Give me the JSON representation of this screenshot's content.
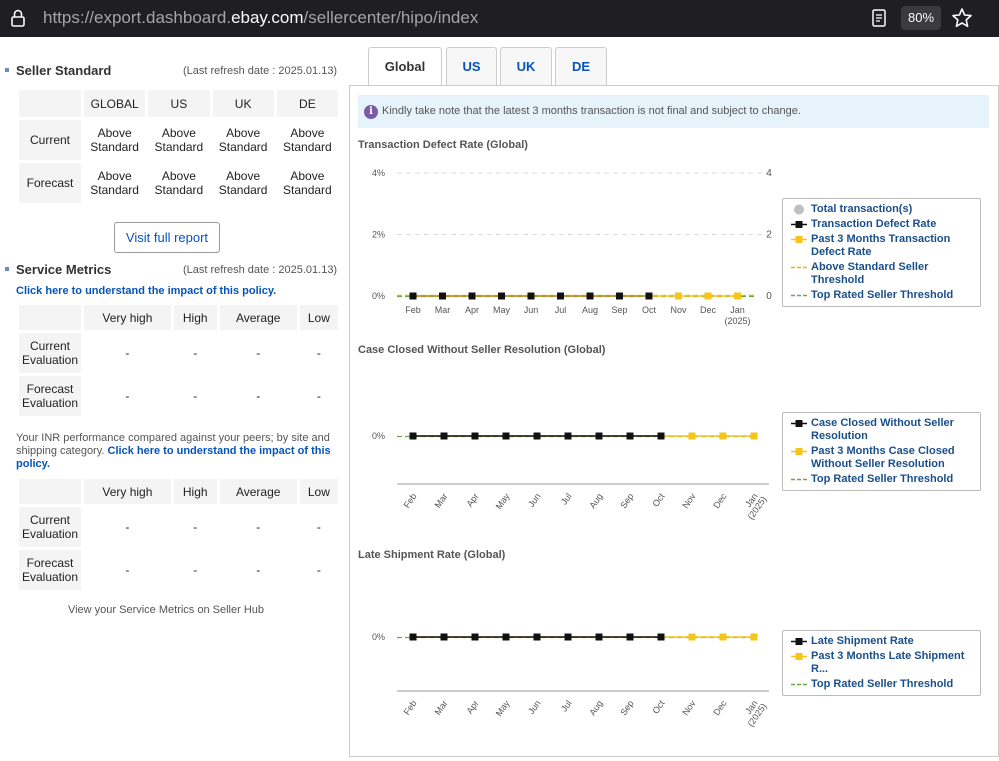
{
  "browser": {
    "url_prefix": "https://export.dashboard.",
    "url_domain": "ebay.com",
    "url_path": "/sellercenter/hipo/index",
    "zoom": "80%"
  },
  "seller_standard": {
    "title": "Seller Standard",
    "refresh": "(Last refresh date : 2025.01.13)",
    "columns": [
      "GLOBAL",
      "US",
      "UK",
      "DE"
    ],
    "rows": [
      {
        "label": "Current",
        "values": [
          "Above Standard",
          "Above Standard",
          "Above Standard",
          "Above Standard"
        ]
      },
      {
        "label": "Forecast",
        "values": [
          "Above Standard",
          "Above Standard",
          "Above Standard",
          "Above Standard"
        ]
      }
    ],
    "button": "Visit full report"
  },
  "service_metrics": {
    "title": "Service Metrics",
    "refresh": "(Last refresh date : 2025.01.13)",
    "policy_link": "Click here to understand the impact of this policy.",
    "columns": [
      "Very high",
      "High",
      "Average",
      "Low"
    ],
    "rows": [
      {
        "label": "Current Evaluation",
        "values": [
          "-",
          "-",
          "-",
          "-"
        ]
      },
      {
        "label": "Forecast Evaluation",
        "values": [
          "-",
          "-",
          "-",
          "-"
        ]
      }
    ],
    "inr_note": "Your INR performance compared against your peers; by site and shipping category.",
    "inr_link": "Click here to understand the impact of this policy.",
    "inr_rows": [
      {
        "label": "Current Evaluation",
        "values": [
          "-",
          "-",
          "-",
          "-"
        ]
      },
      {
        "label": "Forecast Evaluation",
        "values": [
          "-",
          "-",
          "-",
          "-"
        ]
      }
    ],
    "footer": "View your Service Metrics on Seller Hub"
  },
  "tabs": [
    "Global",
    "US",
    "UK",
    "DE"
  ],
  "active_tab": "Global",
  "notice": "Kindly take note that the latest 3 months transaction is not final and subject to change.",
  "colors": {
    "actual": "#111111",
    "forecast": "#f5c518",
    "above_standard": "#e8b800",
    "top_rated": "#6aa84f",
    "total": "#c0c0c0",
    "link": "#0654ba"
  },
  "chart_data": [
    {
      "type": "line",
      "title": "Transaction Defect Rate (Global)",
      "x": [
        "Feb",
        "Mar",
        "Apr",
        "May",
        "Jun",
        "Jul",
        "Aug",
        "Sep",
        "Oct",
        "Nov",
        "Dec",
        "Jan"
      ],
      "x_sub": {
        "Jan": "(2025)"
      },
      "y_ticks": [
        "0%",
        "2%",
        "4%"
      ],
      "y2_ticks": [
        "0",
        "2",
        "4"
      ],
      "ylim": [
        0,
        4
      ],
      "series": [
        {
          "name": "Total transaction(s)",
          "values": []
        },
        {
          "name": "Transaction Defect Rate",
          "values": [
            0,
            0,
            0,
            0,
            0,
            0,
            0,
            0,
            0
          ]
        },
        {
          "name": "Past 3 Months Transaction Defect Rate",
          "values": [
            0,
            0,
            0,
            0,
            0,
            0,
            0,
            0,
            0,
            0,
            0,
            0
          ]
        },
        {
          "name": "Above Standard Seller Threshold",
          "values": []
        },
        {
          "name": "Top Rated Seller Threshold",
          "values": []
        }
      ]
    },
    {
      "type": "line",
      "title": "Case Closed Without Seller Resolution (Global)",
      "x": [
        "Feb",
        "Mar",
        "Apr",
        "May",
        "Jun",
        "Jul",
        "Aug",
        "Sep",
        "Oct",
        "Nov",
        "Dec",
        "Jan"
      ],
      "x_sub": {
        "Jan": "(2025)"
      },
      "y_ticks": [
        "0%"
      ],
      "series": [
        {
          "name": "Case Closed Without Seller Resolution",
          "values": [
            0,
            0,
            0,
            0,
            0,
            0,
            0,
            0,
            0
          ]
        },
        {
          "name": "Past 3 Months Case Closed Without Seller Resolution",
          "values": [
            0,
            0,
            0,
            0,
            0,
            0,
            0,
            0,
            0,
            0,
            0,
            0
          ]
        },
        {
          "name": "Top Rated Seller Threshold",
          "values": []
        }
      ]
    },
    {
      "type": "line",
      "title": "Late Shipment Rate (Global)",
      "x": [
        "Feb",
        "Mar",
        "Apr",
        "May",
        "Jun",
        "Jul",
        "Aug",
        "Sep",
        "Oct",
        "Nov",
        "Dec",
        "Jan"
      ],
      "x_sub": {
        "Jan": "(2025)"
      },
      "y_ticks": [
        "0%"
      ],
      "series": [
        {
          "name": "Late Shipment Rate",
          "values": [
            0,
            0,
            0,
            0,
            0,
            0,
            0,
            0,
            0
          ]
        },
        {
          "name": "Past 3 Months Late Shipment R...",
          "values": [
            0,
            0,
            0,
            0,
            0,
            0,
            0,
            0,
            0,
            0,
            0,
            0
          ]
        },
        {
          "name": "Top Rated Seller Threshold",
          "values": []
        }
      ]
    }
  ]
}
